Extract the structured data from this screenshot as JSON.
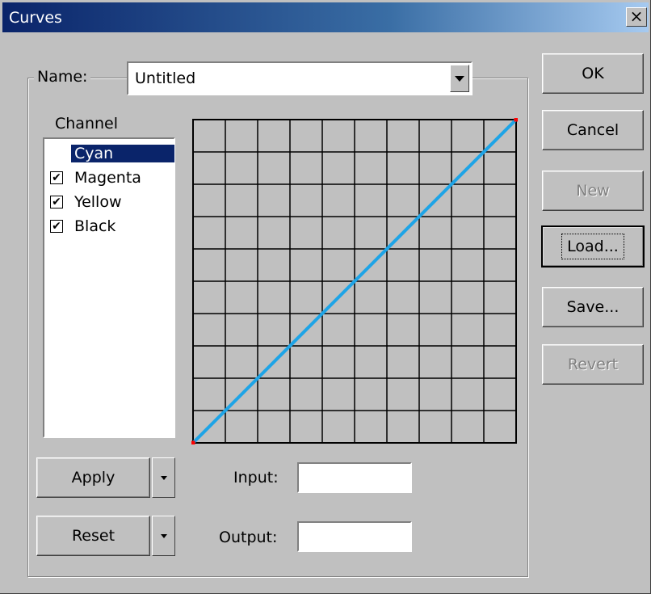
{
  "window": {
    "title": "Curves",
    "close_label": "×"
  },
  "name": {
    "label": "Name:",
    "value": "Untitled"
  },
  "channel": {
    "label": "Channel",
    "items": [
      {
        "label": "Cyan",
        "checked": false,
        "selected": true
      },
      {
        "label": "Magenta",
        "checked": true,
        "selected": false
      },
      {
        "label": "Yellow",
        "checked": true,
        "selected": false
      },
      {
        "label": "Black",
        "checked": true,
        "selected": false
      }
    ]
  },
  "curve": {
    "line_color": "#1ea4e6",
    "point_color": "#ff0000",
    "grid_divisions": 10,
    "points": [
      [
        0,
        0
      ],
      [
        255,
        255
      ]
    ]
  },
  "buttons": {
    "ok": "OK",
    "cancel": "Cancel",
    "new": "New",
    "load": "Load...",
    "save": "Save...",
    "revert": "Revert",
    "apply": "Apply",
    "reset": "Reset"
  },
  "fields": {
    "input_label": "Input:",
    "input_value": "",
    "output_label": "Output:",
    "output_value": ""
  }
}
